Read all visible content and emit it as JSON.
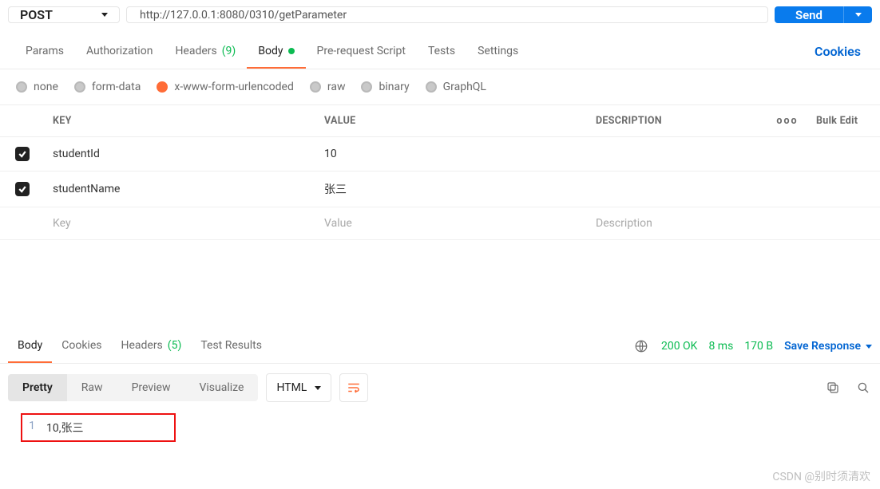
{
  "request": {
    "method": "POST",
    "url": "http://127.0.0.1:8080/0310/getParameter",
    "send_label": "Send"
  },
  "req_tabs": {
    "params": "Params",
    "authorization": "Authorization",
    "headers": "Headers",
    "headers_count": "(9)",
    "body": "Body",
    "pre_request": "Pre-request Script",
    "tests": "Tests",
    "settings": "Settings",
    "cookies": "Cookies"
  },
  "body_types": {
    "none": "none",
    "form_data": "form-data",
    "urlencoded": "x-www-form-urlencoded",
    "raw": "raw",
    "binary": "binary",
    "graphql": "GraphQL"
  },
  "kv": {
    "headers": {
      "key": "KEY",
      "value": "VALUE",
      "description": "DESCRIPTION",
      "more": "ooo",
      "bulk": "Bulk Edit"
    },
    "rows": [
      {
        "key": "studentId",
        "value": "10",
        "description": ""
      },
      {
        "key": "studentName",
        "value": "张三",
        "description": ""
      }
    ],
    "placeholders": {
      "key": "Key",
      "value": "Value",
      "description": "Description"
    }
  },
  "resp_tabs": {
    "body": "Body",
    "cookies": "Cookies",
    "headers": "Headers",
    "headers_count": "(5)",
    "test_results": "Test Results"
  },
  "resp_meta": {
    "status": "200 OK",
    "time": "8 ms",
    "size": "170 B",
    "save": "Save Response"
  },
  "resp_view": {
    "pretty": "Pretty",
    "raw": "Raw",
    "preview": "Preview",
    "visualize": "Visualize",
    "type": "HTML"
  },
  "response_body": {
    "line_no": "1",
    "content": "10,张三"
  },
  "watermark": "CSDN @别时须清欢"
}
